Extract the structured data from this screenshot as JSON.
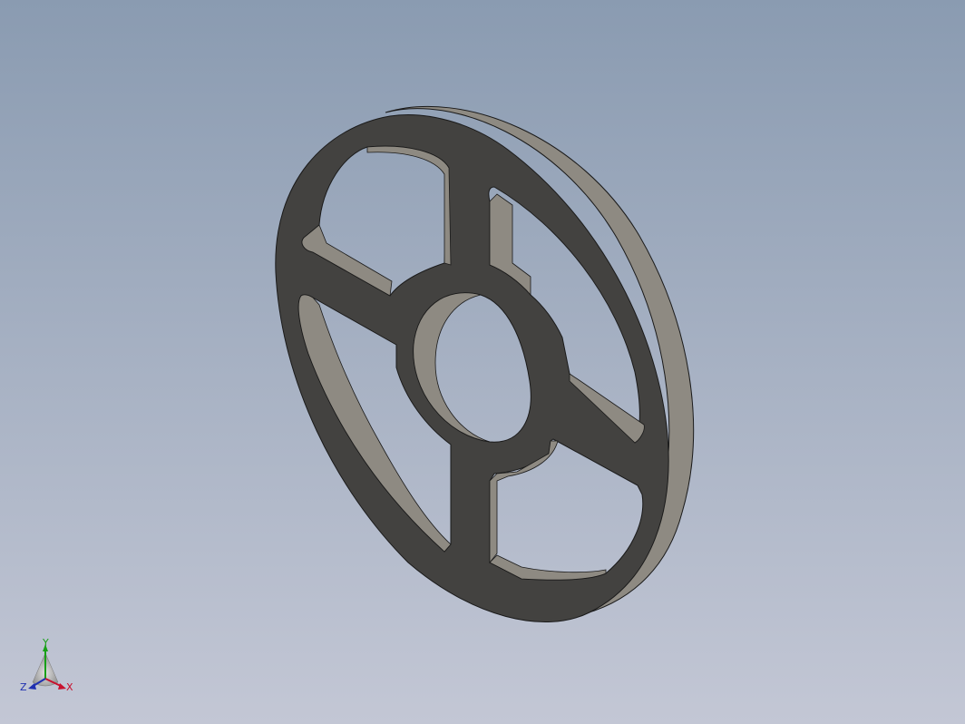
{
  "viewport": {
    "background_top": "#8a9bb1",
    "background_bottom": "#c3c7d5"
  },
  "part": {
    "name": "spoked-ring",
    "face_color": "#434240",
    "side_color": "#8e8a82",
    "edge_color": "#1a1a1a"
  },
  "triad": {
    "x_label": "X",
    "y_label": "Y",
    "z_label": "Z",
    "x_color": "#c8102e",
    "y_color": "#18a018",
    "z_color": "#1f2fb0"
  }
}
